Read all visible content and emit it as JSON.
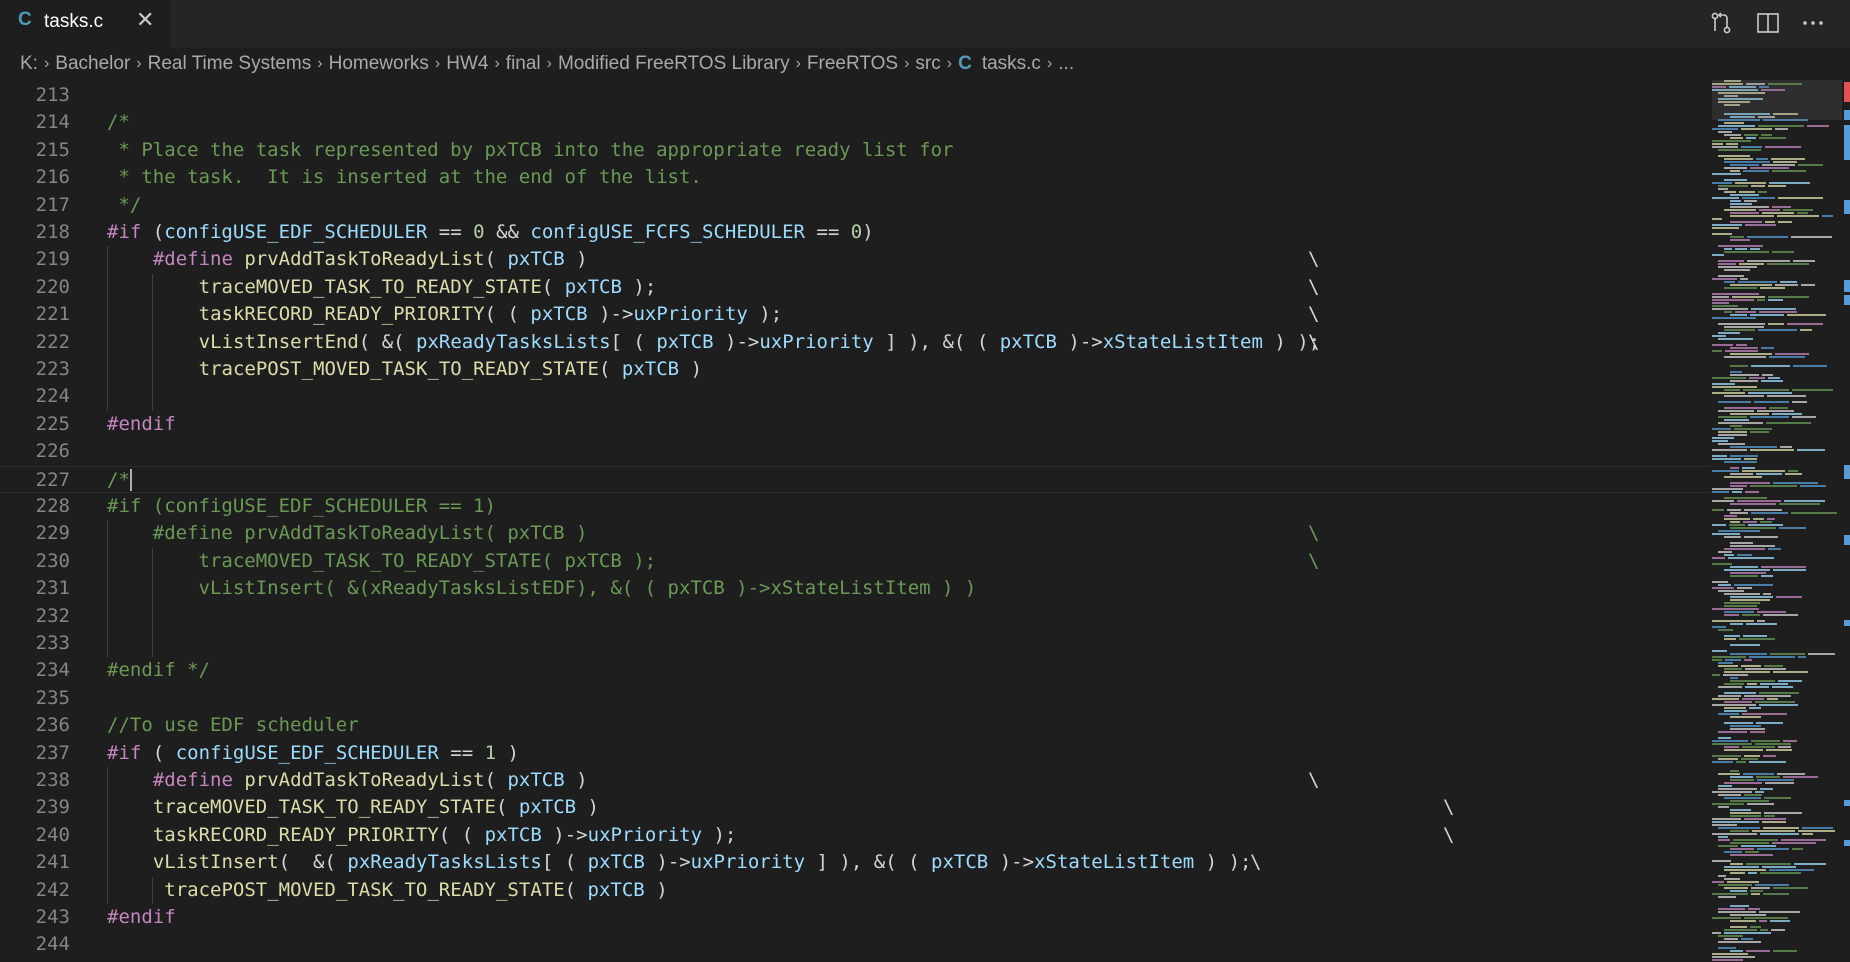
{
  "tab": {
    "icon_letter": "C",
    "title": "tasks.c",
    "close_glyph": "✕"
  },
  "actions": [
    {
      "name": "open-changes-icon"
    },
    {
      "name": "split-editor-icon"
    },
    {
      "name": "more-actions-icon"
    }
  ],
  "breadcrumbs": {
    "items": [
      "K:",
      "Bachelor",
      "Real Time Systems",
      "Homeworks",
      "HW4",
      "final",
      "Modified FreeRTOS Library",
      "FreeRTOS",
      "src"
    ],
    "file_icon": "C",
    "file": "tasks.c",
    "ellipsis": "...",
    "separator": "›"
  },
  "editor": {
    "lines": [
      {
        "n": "213",
        "code": ""
      },
      {
        "n": "214",
        "code": "/*"
      },
      {
        "n": "215",
        "code": " * Place the task represented by pxTCB into the appropriate ready list for"
      },
      {
        "n": "216",
        "code": " * the task.  It is inserted at the end of the list."
      },
      {
        "n": "217",
        "code": " */"
      },
      {
        "n": "218",
        "code": "#if (configUSE_EDF_SCHEDULER == 0 && configUSE_FCFS_SCHEDULER == 0)"
      },
      {
        "n": "219",
        "code": "    #define prvAddTaskToReadyList( pxTCB )",
        "cont": "\\"
      },
      {
        "n": "220",
        "code": "        traceMOVED_TASK_TO_READY_STATE( pxTCB );",
        "cont": "\\"
      },
      {
        "n": "221",
        "code": "        taskRECORD_READY_PRIORITY( ( pxTCB )->uxPriority );",
        "cont": "\\"
      },
      {
        "n": "222",
        "code": "        vListInsertEnd( &( pxReadyTasksLists[ ( pxTCB )->uxPriority ] ), &( ( pxTCB )->xStateListItem ) );",
        "cont": "\\"
      },
      {
        "n": "223",
        "code": "        tracePOST_MOVED_TASK_TO_READY_STATE( pxTCB )"
      },
      {
        "n": "224",
        "code": ""
      },
      {
        "n": "225",
        "code": "#endif"
      },
      {
        "n": "226",
        "code": ""
      },
      {
        "n": "227",
        "code": "/*"
      },
      {
        "n": "228",
        "code": "#if (configUSE_EDF_SCHEDULER == 1)"
      },
      {
        "n": "229",
        "code": "    #define prvAddTaskToReadyList( pxTCB )",
        "cont": "\\"
      },
      {
        "n": "230",
        "code": "        traceMOVED_TASK_TO_READY_STATE( pxTCB );",
        "cont": "\\"
      },
      {
        "n": "231",
        "code": "        vListInsert( &(xReadyTasksListEDF), &( ( pxTCB )->xStateListItem ) )"
      },
      {
        "n": "232",
        "code": ""
      },
      {
        "n": "233",
        "code": ""
      },
      {
        "n": "234",
        "code": "#endif */"
      },
      {
        "n": "235",
        "code": ""
      },
      {
        "n": "236",
        "code": "//To use EDF scheduler"
      },
      {
        "n": "237",
        "code": "#if ( configUSE_EDF_SCHEDULER == 1 )"
      },
      {
        "n": "238",
        "code": "    #define prvAddTaskToReadyList( pxTCB )",
        "cont": "\\"
      },
      {
        "n": "239",
        "code": "    traceMOVED_TASK_TO_READY_STATE( pxTCB )",
        "cont": "\\"
      },
      {
        "n": "240",
        "code": "    taskRECORD_READY_PRIORITY( ( pxTCB )->uxPriority );",
        "cont": "\\"
      },
      {
        "n": "241",
        "code": "    vListInsert(  &( pxReadyTasksLists[ ( pxTCB )->uxPriority ] ), &( ( pxTCB )->xStateListItem ) );",
        "cont": "\\"
      },
      {
        "n": "242",
        "code": "     tracePOST_MOVED_TASK_TO_READY_STATE( pxTCB )"
      },
      {
        "n": "243",
        "code": "#endif"
      },
      {
        "n": "244",
        "code": ""
      }
    ]
  }
}
